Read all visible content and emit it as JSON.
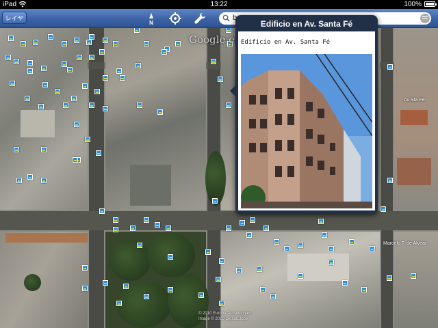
{
  "status_bar": {
    "device": "iPad",
    "time": "13:22",
    "battery": "100%",
    "battery_level": 1.0
  },
  "toolbar": {
    "layers_label": "レイヤ",
    "compass_icon": "compass-north-icon",
    "location_icon": "location-target-icon",
    "tools_icon": "wrench-icon",
    "search_value": "b"
  },
  "map": {
    "watermark": "Google ea",
    "copyright": [
      "© 2010 Europa Technologies",
      "Image © 2010 DigitalGlobe"
    ],
    "street_labels": {
      "sta_fe": "Av Sta Fe",
      "alvear": "Marcelo T. de Alvear"
    }
  },
  "popup": {
    "title": "Edificio en Av. Santa Fé",
    "caption": "Edificio en Av. Santa Fé",
    "photo_subject": "corner apartment building"
  },
  "colors": {
    "toolbar": "#3d63a6",
    "popup_frame": "#223047",
    "marker": "#2a8cd8"
  }
}
